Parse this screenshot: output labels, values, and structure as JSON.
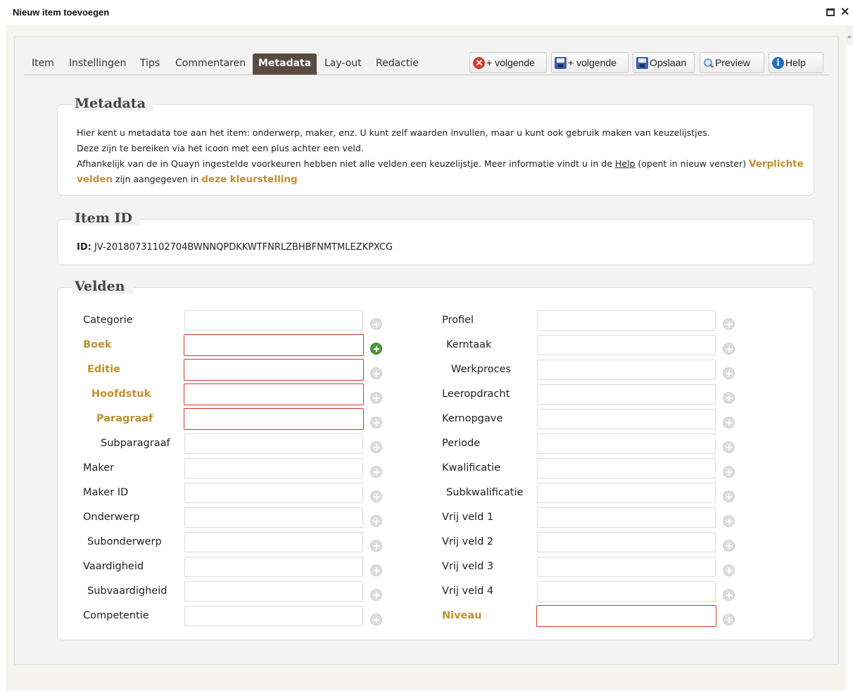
{
  "window": {
    "title": "Nieuw item toevoegen",
    "close_glyph": "✕"
  },
  "tabs": [
    {
      "label": "Item"
    },
    {
      "label": "Instellingen"
    },
    {
      "label": "Tips"
    },
    {
      "label": "Commentaren"
    },
    {
      "label": "Metadata",
      "active": true
    },
    {
      "label": "Lay-out"
    },
    {
      "label": "Redactie"
    }
  ],
  "toolbar": {
    "cancel_next_label": "+ volgende",
    "save_next_label": "+ volgende",
    "save_label": "Opslaan",
    "preview_label": "Preview",
    "help_label": "Help",
    "help_glyph": "i"
  },
  "metadata": {
    "legend": "Metadata",
    "intro_line1": "Hier kent u metadata toe aan het item: onderwerp, maker, enz. U kunt zelf waarden invullen, maar u kunt ook gebruik maken van keuzelijstjes.",
    "intro_line2": "Deze zijn te bereiken via het icoon met een plus achter een veld.",
    "intro_line3_before_link": "Afhankelijk van de in Quayn ingestelde voorkeuren hebben niet alle velden een keuzelijstje. Meer informatie vindt u in de ",
    "help_link": "Help",
    "intro_line3_after_link": " (opent in nieuw venster) ",
    "required_fields_text": "Verplichte velden",
    "indicated_in_text": " zijn aangegeven in ",
    "color_setting_text": "deze kleurstelling"
  },
  "item_id": {
    "legend": "Item ID",
    "label": "ID:",
    "value": " JV-20180731102704BWNNQPDKKWTFNRLZBHBFNMTMLEZKPXCG"
  },
  "fields": {
    "legend": "Velden",
    "left": [
      {
        "label": "Categorie",
        "required": false
      },
      {
        "label": "Boek",
        "required": true
      },
      {
        "label": "Editie",
        "required": true
      },
      {
        "label": "Hoofdstuk",
        "required": true
      },
      {
        "label": "Paragraaf",
        "required": true
      },
      {
        "label": "Subparagraaf",
        "required": false
      },
      {
        "label": "Maker",
        "required": false
      },
      {
        "label": "Maker ID",
        "required": false
      },
      {
        "label": "Onderwerp",
        "required": false
      },
      {
        "label": "Subonderwerp",
        "required": false
      },
      {
        "label": "Vaardigheid",
        "required": false
      },
      {
        "label": "Subvaardigheid",
        "required": false
      },
      {
        "label": "Competentie",
        "required": false
      }
    ],
    "right": [
      {
        "label": "Profiel",
        "required": false
      },
      {
        "label": "Kerntaak",
        "required": false
      },
      {
        "label": "Werkproces",
        "required": false
      },
      {
        "label": "Leeropdracht",
        "required": false
      },
      {
        "label": "Kernopgave",
        "required": false
      },
      {
        "label": "Periode",
        "required": false
      },
      {
        "label": "Kwalificatie",
        "required": false
      },
      {
        "label": "Subkwalificatie",
        "required": false
      },
      {
        "label": "Vrij veld 1",
        "required": false
      },
      {
        "label": "Vrij veld 2",
        "required": false
      },
      {
        "label": "Vrij veld 3",
        "required": false
      },
      {
        "label": "Vrij veld 4",
        "required": false
      },
      {
        "label": "Niveau",
        "required": true
      }
    ]
  },
  "colors": {
    "active_tab_bg": "#5a4a42",
    "required_label": "#c0902c",
    "required_border": "#d8362a",
    "plus_active": "#4f9a3d"
  },
  "icons": [
    "maximize-icon",
    "close-icon",
    "cancel-icon",
    "save-icon",
    "preview-icon",
    "help-icon",
    "add-plus-icon"
  ]
}
